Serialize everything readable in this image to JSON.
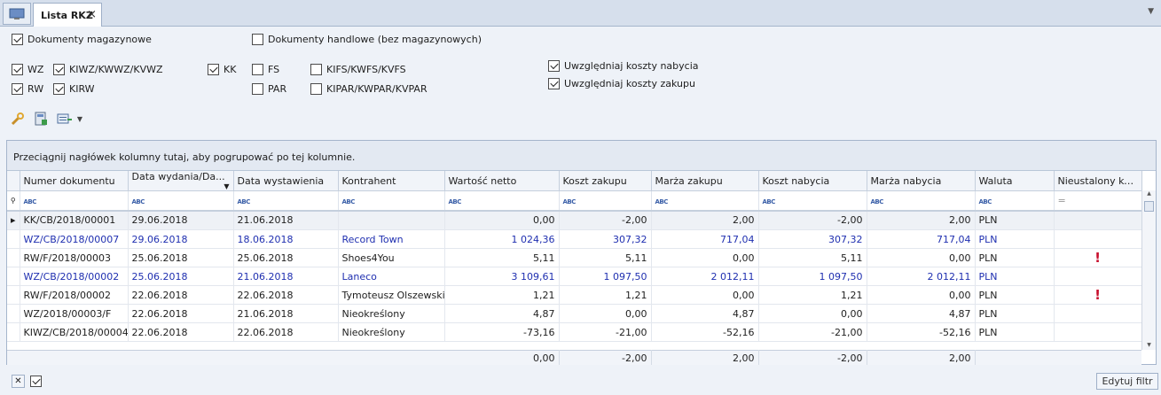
{
  "tab": {
    "title": "Lista RKZ",
    "close": "×"
  },
  "filters": {
    "dok_mag": "Dokumenty magazynowe",
    "dok_handl": "Dokumenty handlowe (bez magazynowych)",
    "wz": "WZ",
    "kiwz": "KIWZ/KWWZ/KVWZ",
    "kk": "KK",
    "fs": "FS",
    "kifs": "KIFS/KWFS/KVFS",
    "rw": "RW",
    "kirw": "KIRW",
    "par": "PAR",
    "kipar": "KIPAR/KWPAR/KVPAR",
    "koszty_nabycia": "Uwzględniaj koszty nabycia",
    "koszty_zakupu": "Uwzględniaj koszty zakupu"
  },
  "grid": {
    "group_hint": "Przeciągnij nagłówek kolumny tutaj, aby pogrupować po tej kolumnie.",
    "columns": [
      "Numer dokumentu",
      "Data wydania/Da...",
      "Data wystawienia",
      "Kontrahent",
      "Wartość netto",
      "Koszt zakupu",
      "Marża zakupu",
      "Koszt nabycia",
      "Marża nabycia",
      "Waluta",
      "Nieustalony ko..."
    ],
    "rows": [
      {
        "c": [
          "KK/CB/2018/00001",
          "29.06.2018",
          "21.06.2018",
          "",
          "0,00",
          "-2,00",
          "2,00",
          "-2,00",
          "2,00",
          "PLN",
          ""
        ]
      },
      {
        "c": [
          "WZ/CB/2018/00007",
          "29.06.2018",
          "18.06.2018",
          "Record Town",
          "1 024,36",
          "307,32",
          "717,04",
          "307,32",
          "717,04",
          "PLN",
          ""
        ]
      },
      {
        "c": [
          "RW/F/2018/00003",
          "25.06.2018",
          "25.06.2018",
          "Shoes4You",
          "5,11",
          "5,11",
          "0,00",
          "5,11",
          "0,00",
          "PLN",
          "!"
        ]
      },
      {
        "c": [
          "WZ/CB/2018/00002",
          "25.06.2018",
          "21.06.2018",
          "Laneco",
          "3 109,61",
          "1 097,50",
          "2 012,11",
          "1 097,50",
          "2 012,11",
          "PLN",
          ""
        ]
      },
      {
        "c": [
          "RW/F/2018/00002",
          "22.06.2018",
          "22.06.2018",
          "Tymoteusz Olszewski",
          "1,21",
          "1,21",
          "0,00",
          "1,21",
          "0,00",
          "PLN",
          "!"
        ]
      },
      {
        "c": [
          "WZ/2018/00003/F",
          "22.06.2018",
          "21.06.2018",
          "Nieokreślony",
          "4,87",
          "0,00",
          "4,87",
          "0,00",
          "4,87",
          "PLN",
          ""
        ]
      },
      {
        "c": [
          "KIWZ/CB/2018/00004",
          "22.06.2018",
          "22.06.2018",
          "Nieokreślony",
          "-73,16",
          "-21,00",
          "-52,16",
          "-21,00",
          "-52,16",
          "PLN",
          ""
        ]
      }
    ],
    "totals": {
      "netto": "0,00",
      "kzak": "-2,00",
      "mzak": "2,00",
      "knab": "-2,00",
      "mnab": "2,00"
    },
    "abc": "ABC",
    "eq": "="
  },
  "bottom": {
    "edit_filter": "Edytuj filtr"
  }
}
